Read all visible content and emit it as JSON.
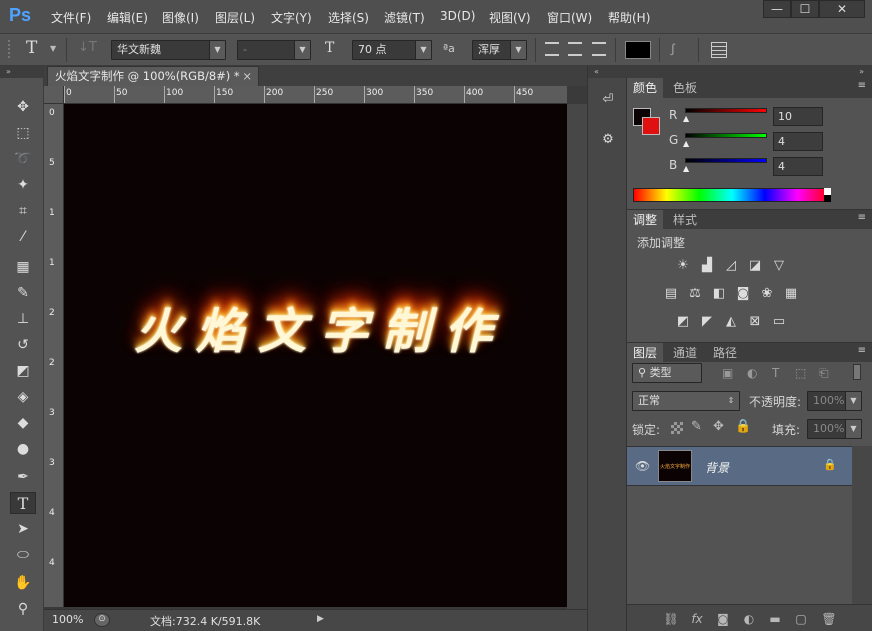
{
  "app": {
    "logo": "Ps"
  },
  "menu": [
    "文件(F)",
    "编辑(E)",
    "图像(I)",
    "图层(L)",
    "文字(Y)",
    "选择(S)",
    "滤镜(T)",
    "3D(D)",
    "视图(V)",
    "窗口(W)",
    "帮助(H)"
  ],
  "window_controls": {
    "minimize": "—",
    "maximize": "☐",
    "close": "✕"
  },
  "options": {
    "tool_icon": "T",
    "font_family": "华文新魏",
    "font_style": "-",
    "font_size": "70 点",
    "aa_icon": "ªa",
    "aa_mode": "浑厚"
  },
  "document": {
    "tab_title": "火焰文字制作 @ 100%(RGB/8#) *",
    "close": "×",
    "canvas_text": "火焰文字制作",
    "ruler_top": [
      "0",
      "50",
      "100",
      "150",
      "200",
      "250",
      "300",
      "350",
      "400",
      "450"
    ],
    "ruler_left": [
      "0",
      "5",
      "1",
      "1",
      "2",
      "2",
      "3",
      "3",
      "4",
      "4"
    ]
  },
  "status": {
    "zoom": "100%",
    "doc_info": "文档:732.4 K/591.8K"
  },
  "color_panel": {
    "tabs": [
      "颜色",
      "色板"
    ],
    "r_label": "R",
    "g_label": "G",
    "b_label": "B",
    "r": "10",
    "g": "4",
    "b": "4",
    "fg_color": "#0a0404",
    "bg_color": "#e01010"
  },
  "adjust_panel": {
    "tabs": [
      "调整",
      "样式"
    ],
    "title": "添加调整"
  },
  "layers_panel": {
    "tabs": [
      "图层",
      "通道",
      "路径"
    ],
    "filter_type": "类型",
    "blend_mode": "正常",
    "opacity_label": "不透明度:",
    "opacity": "100%",
    "lock_label": "锁定:",
    "fill_label": "填充:",
    "fill": "100%",
    "layers": [
      {
        "name": "背景",
        "thumb_text": "火焰文字制作"
      }
    ]
  },
  "colors": {
    "accent": "#4da3ff",
    "layer_selected": "#596b84"
  }
}
